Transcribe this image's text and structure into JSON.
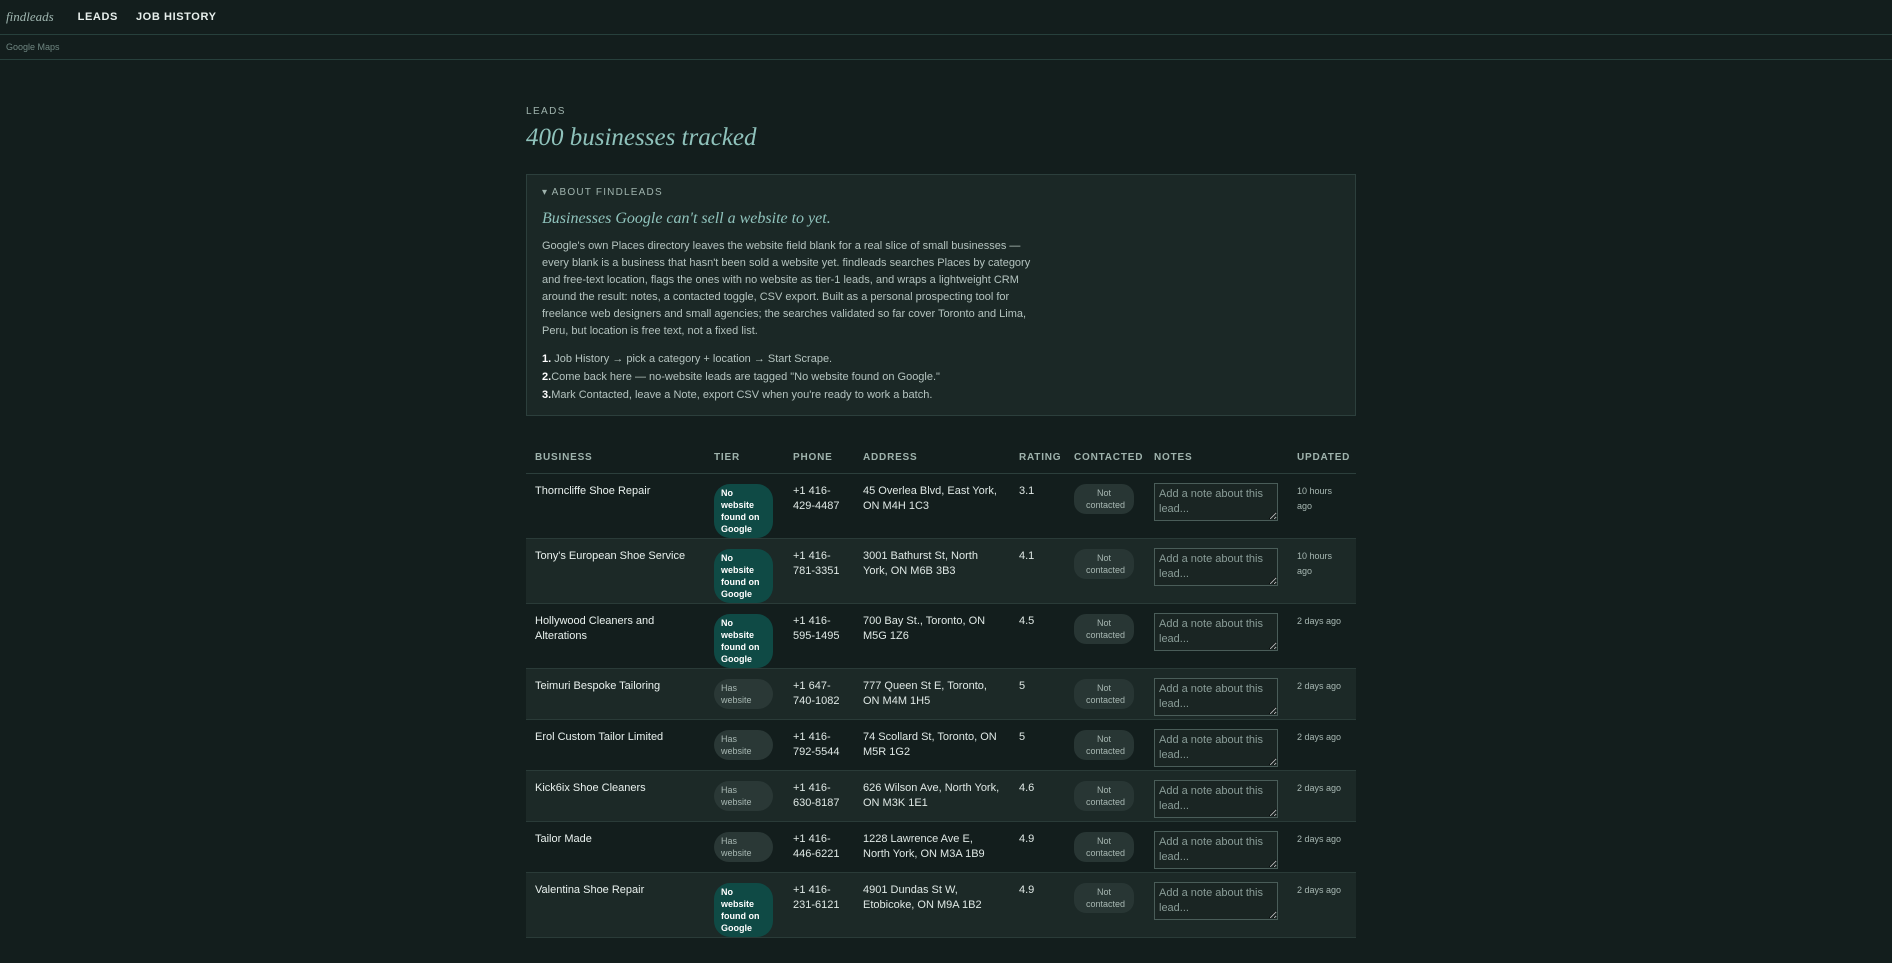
{
  "nav": {
    "logo": "findleads",
    "links": [
      "LEADS",
      "JOB HISTORY"
    ],
    "sub": "Google Maps"
  },
  "header": {
    "eyebrow": "LEADS",
    "title": "400 businesses tracked"
  },
  "about": {
    "toggle": "▾ ABOUT FINDLEADS",
    "heading": "Businesses Google can't sell a website to yet.",
    "body": "Google's own Places directory leaves the website field blank for a real slice of small businesses — every blank is a business that hasn't been sold a website yet. findleads searches Places by category and free-text location, flags the ones with no website as tier-1 leads, and wraps a lightweight CRM around the result: notes, a contacted toggle, CSV export. Built as a personal prospecting tool for freelance web designers and small agencies; the searches validated so far cover Toronto and Lima, Peru, but location is free text, not a fixed list.",
    "steps": [
      {
        "num": "1.",
        "text": " Job History → pick a category + location → Start Scrape."
      },
      {
        "num": "2.",
        "text": "Come back here — no-website leads are tagged \"No website found on Google.\""
      },
      {
        "num": "3.",
        "text": "Mark Contacted, leave a Note, export CSV when you're ready to work a batch."
      }
    ]
  },
  "table": {
    "columns": [
      "BUSINESS",
      "TIER",
      "PHONE",
      "ADDRESS",
      "RATING",
      "CONTACTED",
      "NOTES",
      "UPDATED"
    ],
    "note_placeholder": "Add a note about this lead...",
    "rows": [
      {
        "business": "Thorncliffe Shoe Repair",
        "tier": "No website found on Google",
        "tier_kind": "nw",
        "phone": "+1 416-429-4487",
        "address": "45 Overlea Blvd, East York, ON M4H 1C3",
        "rating": "3.1",
        "contacted": "Not contacted",
        "updated": "10 hours ago"
      },
      {
        "business": "Tony's European Shoe Service",
        "tier": "No website found on Google",
        "tier_kind": "nw",
        "phone": "+1 416-781-3351",
        "address": "3001 Bathurst St, North York, ON M6B 3B3",
        "rating": "4.1",
        "contacted": "Not contacted",
        "updated": "10 hours ago"
      },
      {
        "business": "Hollywood Cleaners and Alterations",
        "tier": "No website found on Google",
        "tier_kind": "nw",
        "phone": "+1 416-595-1495",
        "address": "700 Bay St., Toronto, ON M5G 1Z6",
        "rating": "4.5",
        "contacted": "Not contacted",
        "updated": "2 days ago"
      },
      {
        "business": "Teimuri Bespoke Tailoring",
        "tier": "Has website",
        "tier_kind": "hw",
        "phone": "+1 647-740-1082",
        "address": "777 Queen St E, Toronto, ON M4M 1H5",
        "rating": "5",
        "contacted": "Not contacted",
        "updated": "2 days ago"
      },
      {
        "business": "Erol Custom Tailor Limited",
        "tier": "Has website",
        "tier_kind": "hw",
        "phone": "+1 416-792-5544",
        "address": "74 Scollard St, Toronto, ON M5R 1G2",
        "rating": "5",
        "contacted": "Not contacted",
        "updated": "2 days ago"
      },
      {
        "business": "Kick6ix Shoe Cleaners",
        "tier": "Has website",
        "tier_kind": "hw",
        "phone": "+1 416-630-8187",
        "address": "626 Wilson Ave, North York, ON M3K 1E1",
        "rating": "4.6",
        "contacted": "Not contacted",
        "updated": "2 days ago"
      },
      {
        "business": "Tailor Made",
        "tier": "Has website",
        "tier_kind": "hw",
        "phone": "+1 416-446-6221",
        "address": "1228 Lawrence Ave E, North York, ON M3A 1B9",
        "rating": "4.9",
        "contacted": "Not contacted",
        "updated": "2 days ago"
      },
      {
        "business": "Valentina Shoe Repair",
        "tier": "No website found on Google",
        "tier_kind": "nw",
        "phone": "+1 416-231-6121",
        "address": "4901 Dundas St W, Etobicoke, ON M9A 1B2",
        "rating": "4.9",
        "contacted": "Not contacted",
        "updated": "2 days ago"
      }
    ]
  }
}
